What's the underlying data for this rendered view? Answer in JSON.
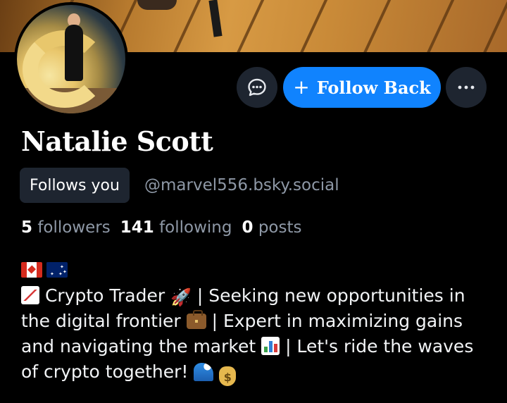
{
  "profile": {
    "display_name": "Natalie Scott",
    "follows_you_label": "Follows you",
    "handle": "@marvel556.bsky.social",
    "follow_button_label": "Follow Back",
    "stats": {
      "followers_count": "5",
      "followers_label": "followers",
      "following_count": "141",
      "following_label": "following",
      "posts_count": "0",
      "posts_label": "posts"
    },
    "bio": {
      "flags": [
        "canada-flag-icon",
        "australia-flag-icon"
      ],
      "segment_1": "Crypto Trader",
      "segment_2": "| Seeking new opportunities in the digital frontier",
      "segment_3": "| Expert in maximizing gains and navigating the market",
      "segment_4": "| Let's ride the waves of crypto together!"
    }
  },
  "icons": {
    "chat": "chat-bubble-icon",
    "more": "more-horizontal-icon",
    "plus": "plus-icon"
  },
  "colors": {
    "accent": "#1083fe",
    "background": "#000000",
    "muted_text": "#8e98a6",
    "chip_bg": "#1e2530"
  }
}
